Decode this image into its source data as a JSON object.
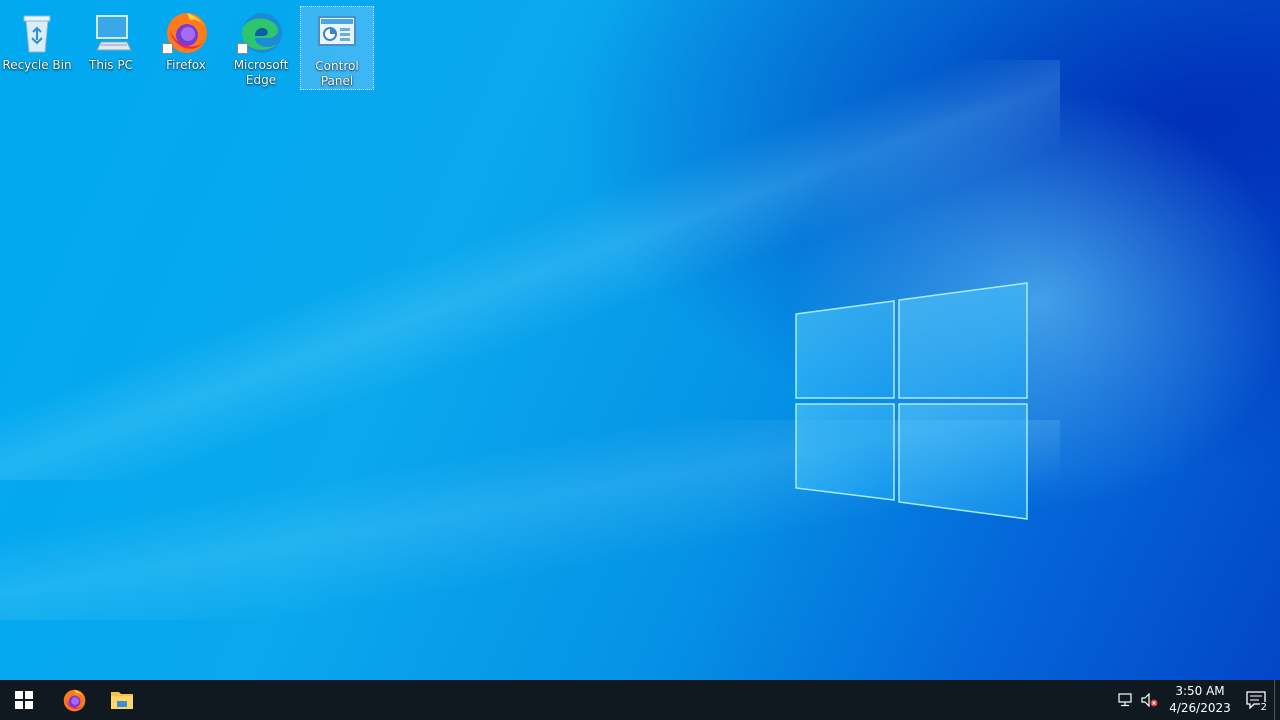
{
  "desktop": {
    "icons": [
      {
        "label": "Recycle Bin",
        "icon": "recycle-bin-icon"
      },
      {
        "label": "This PC",
        "icon": "this-pc-icon"
      },
      {
        "label": "Firefox",
        "icon": "firefox-icon"
      },
      {
        "label": "Microsoft Edge",
        "icon": "edge-icon"
      },
      {
        "label": "Control Panel",
        "icon": "control-panel-icon",
        "selected": true
      }
    ]
  },
  "taskbar": {
    "pinned": [
      {
        "icon": "windows-start-icon"
      },
      {
        "icon": "firefox-icon"
      },
      {
        "icon": "file-explorer-icon"
      }
    ],
    "tray": {
      "network_icon": "network-icon",
      "volume_icon": "volume-muted-icon",
      "time": "3:50 AM",
      "date": "4/26/2023",
      "notification_count": "2"
    }
  },
  "colors": {
    "taskbar_bg": "#101820",
    "wallpaper_accent": "#0aa8ee"
  }
}
